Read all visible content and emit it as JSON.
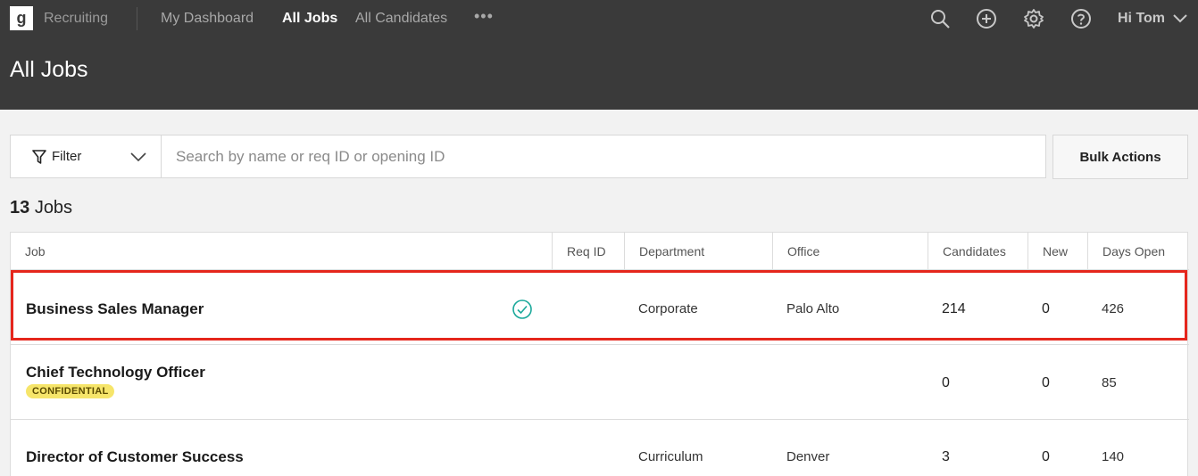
{
  "topbar": {
    "logo": "g",
    "app_name": "Recruiting",
    "nav": [
      "My Dashboard",
      "All Jobs",
      "All Candidates"
    ],
    "more": "•••",
    "icons": [
      "search-icon",
      "plus-circle-icon",
      "gear-icon",
      "help-icon"
    ],
    "greeting": "Hi Tom",
    "page_title": "All Jobs"
  },
  "toolbar": {
    "filter_label": "Filter",
    "search_placeholder": "Search by name or req ID or opening ID",
    "bulk_label": "Bulk Actions"
  },
  "summary": {
    "count": "13",
    "unit": "Jobs"
  },
  "table": {
    "columns": [
      "Job",
      "Req ID",
      "Department",
      "Office",
      "Candidates",
      "New",
      "Days Open"
    ],
    "rows": [
      {
        "job": "Business Sales Manager",
        "status_icon": "check-circle-icon",
        "req_id": "",
        "department": "Corporate",
        "office": "Palo Alto",
        "candidates": "214",
        "new": "0",
        "days_open": "426"
      },
      {
        "job": "Chief Technology Officer",
        "badge": "CONFIDENTIAL",
        "req_id": "",
        "department": "",
        "office": "",
        "candidates": "0",
        "new": "0",
        "days_open": "85"
      },
      {
        "job": "Director of Customer Success",
        "req_id": "",
        "department": "Curriculum",
        "office": "Denver",
        "candidates": "3",
        "new": "0",
        "days_open": "140"
      }
    ]
  },
  "colors": {
    "topbar": "#3a3a3a",
    "highlight": "#e5261c",
    "badge": "#f6e56a",
    "check": "#1aa89a"
  }
}
